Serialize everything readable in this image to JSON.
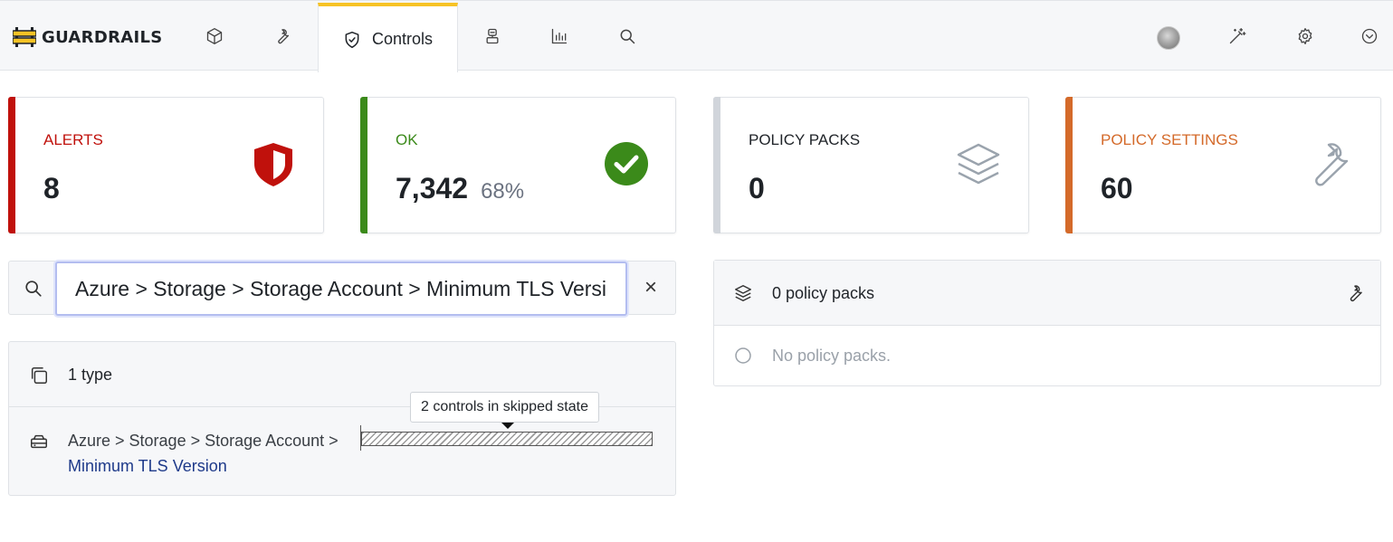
{
  "app": {
    "brand": "GUARDRAILS"
  },
  "nav": {
    "active_tab_label": "Controls",
    "icons": [
      "cube-icon",
      "wrench-icon",
      "shield-check-icon",
      "bot-icon",
      "bar-chart-icon",
      "search-icon",
      "avatar",
      "magic-wand-icon",
      "gear-icon",
      "chevron-down-circle-icon"
    ]
  },
  "cards": {
    "alerts": {
      "label": "ALERTS",
      "value": "8",
      "color": "#c0110c"
    },
    "ok": {
      "label": "OK",
      "value": "7,342",
      "percent": "68%",
      "color": "#3b8a1a"
    },
    "policy_packs": {
      "label": "POLICY PACKS",
      "value": "0",
      "color": "#d1d5db"
    },
    "policy_settings": {
      "label": "POLICY SETTINGS",
      "value": "60",
      "color": "#d46a2a"
    }
  },
  "search": {
    "value": "Azure > Storage > Storage Account > Minimum TLS Version",
    "clear_label": "×"
  },
  "types": {
    "header": "1 type",
    "rows": [
      {
        "path_prefix": "Azure > Storage > Storage Account > ",
        "path_leaf": "Minimum TLS Version",
        "tooltip": "2 controls in skipped state",
        "skipped_count": 2
      }
    ]
  },
  "policy_packs_panel": {
    "header": "0 policy packs",
    "empty_text": "No policy packs."
  }
}
